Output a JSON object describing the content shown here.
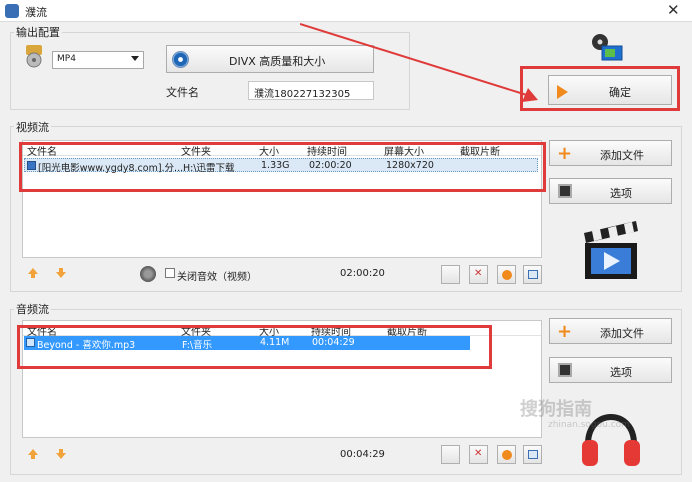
{
  "window": {
    "title": "濮流",
    "close_glyph": "✕"
  },
  "output": {
    "group_label": "输出配置",
    "format_value": "MP4",
    "quality_label": "DIVX 高质量和大小",
    "filename_label": "文件名",
    "filename_value": "濮流180227132305",
    "confirm_label": "确定"
  },
  "video": {
    "group_label": "视频流",
    "columns": [
      "文件名",
      "文件夹",
      "大小",
      "持续时间",
      "屏幕大小",
      "截取片断"
    ],
    "rows": [
      {
        "filename": "[阳光电影www.ygdy8.com].分...",
        "folder": "H:\\迅雷下载",
        "size": "1.33G",
        "duration": "02:00:20",
        "resolution": "1280x720",
        "clip": ""
      }
    ],
    "add_file_label": "添加文件",
    "options_label": "选项",
    "mute_label": "关闭音效（视频）",
    "total_duration": "02:00:20"
  },
  "audio": {
    "group_label": "音频流",
    "columns": [
      "文件名",
      "文件夹",
      "大小",
      "持续时间",
      "截取片断"
    ],
    "rows": [
      {
        "filename": "Beyond - 喜欢你.mp3",
        "folder": "F:\\音乐",
        "size": "4.11M",
        "duration": "00:04:29",
        "clip": ""
      }
    ],
    "add_file_label": "添加文件",
    "options_label": "选项",
    "total_duration": "00:04:29"
  },
  "watermark": {
    "text_cn": "搜狗指南",
    "text_url": "zhinan.sogou.com"
  },
  "colors": {
    "annotation_red": "#e03b3b",
    "selection_blue": "#3399ff",
    "plus_orange": "#f08a1c"
  }
}
